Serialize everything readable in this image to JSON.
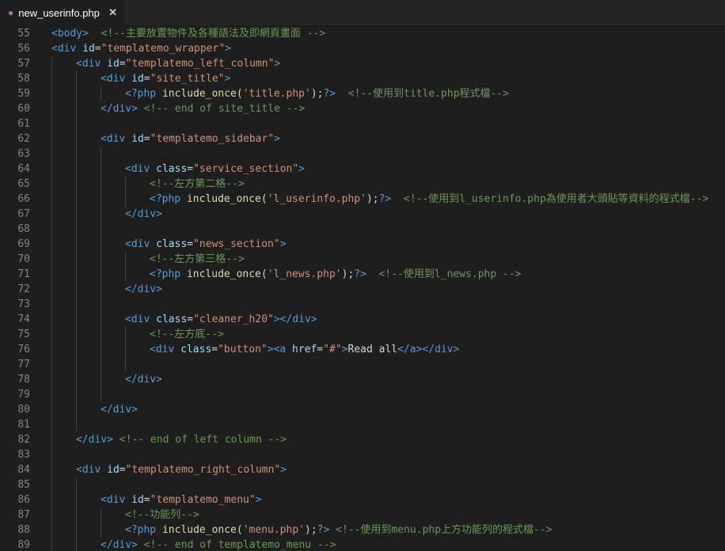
{
  "tab": {
    "filename": "new_userinfo.php",
    "file_icon": "php-elephant-icon",
    "close_glyph": "✕"
  },
  "lines": [
    {
      "n": "55",
      "indent": 0,
      "tokens": [
        [
          "tg",
          "<body>"
        ],
        [
          "tx",
          "  "
        ],
        [
          "cm",
          "<!--主要放置物件及各種語法及即網頁畫面 -->"
        ]
      ]
    },
    {
      "n": "56",
      "indent": 0,
      "tokens": [
        [
          "tg",
          "<div "
        ],
        [
          "at",
          "id"
        ],
        [
          "tx",
          "="
        ],
        [
          "st",
          "\"templatemo_wrapper\""
        ],
        [
          "tg",
          ">"
        ]
      ]
    },
    {
      "n": "57",
      "indent": 1,
      "tokens": [
        [
          "tg",
          "<div "
        ],
        [
          "at",
          "id"
        ],
        [
          "tx",
          "="
        ],
        [
          "st",
          "\"templatemo_left_column\""
        ],
        [
          "tg",
          ">"
        ]
      ]
    },
    {
      "n": "58",
      "indent": 2,
      "tokens": [
        [
          "tg",
          "<div "
        ],
        [
          "at",
          "id"
        ],
        [
          "tx",
          "="
        ],
        [
          "st",
          "\"site_title\""
        ],
        [
          "tg",
          ">"
        ]
      ]
    },
    {
      "n": "59",
      "indent": 3,
      "tokens": [
        [
          "ph",
          "<?php "
        ],
        [
          "fn",
          "include_once"
        ],
        [
          "tx",
          "("
        ],
        [
          "st",
          "'title.php'"
        ],
        [
          "tx",
          ");"
        ],
        [
          "ph",
          "?>"
        ],
        [
          "tx",
          "  "
        ],
        [
          "cm",
          "<!--使用到title.php程式檔-->"
        ]
      ]
    },
    {
      "n": "60",
      "indent": 2,
      "tokens": [
        [
          "tg",
          "</div>"
        ],
        [
          "tx",
          " "
        ],
        [
          "cm",
          "<!-- end of site_title -->"
        ]
      ]
    },
    {
      "n": "61",
      "indent": 0,
      "tokens": []
    },
    {
      "n": "62",
      "indent": 2,
      "tokens": [
        [
          "tg",
          "<div "
        ],
        [
          "at",
          "id"
        ],
        [
          "tx",
          "="
        ],
        [
          "st",
          "\"templatemo_sidebar\""
        ],
        [
          "tg",
          ">"
        ]
      ]
    },
    {
      "n": "63",
      "indent": 0,
      "tokens": []
    },
    {
      "n": "64",
      "indent": 3,
      "tokens": [
        [
          "tg",
          "<div "
        ],
        [
          "at",
          "class"
        ],
        [
          "tx",
          "="
        ],
        [
          "st",
          "\"service_section\""
        ],
        [
          "tg",
          ">"
        ]
      ]
    },
    {
      "n": "65",
      "indent": 4,
      "tokens": [
        [
          "cm",
          "<!--左方第二格-->"
        ]
      ]
    },
    {
      "n": "66",
      "indent": 4,
      "tokens": [
        [
          "ph",
          "<?php "
        ],
        [
          "fn",
          "include_once"
        ],
        [
          "tx",
          "("
        ],
        [
          "st",
          "'l_userinfo.php'"
        ],
        [
          "tx",
          ");"
        ],
        [
          "ph",
          "?>"
        ],
        [
          "tx",
          "  "
        ],
        [
          "cm",
          "<!--使用到l_userinfo.php為使用者大頭貼等資料的程式檔-->"
        ]
      ]
    },
    {
      "n": "67",
      "indent": 3,
      "tokens": [
        [
          "tg",
          "</div>"
        ]
      ]
    },
    {
      "n": "68",
      "indent": 0,
      "tokens": []
    },
    {
      "n": "69",
      "indent": 3,
      "tokens": [
        [
          "tg",
          "<div "
        ],
        [
          "at",
          "class"
        ],
        [
          "tx",
          "="
        ],
        [
          "st",
          "\"news_section\""
        ],
        [
          "tg",
          ">"
        ]
      ]
    },
    {
      "n": "70",
      "indent": 4,
      "tokens": [
        [
          "cm",
          "<!--左方第三格-->"
        ]
      ]
    },
    {
      "n": "71",
      "indent": 4,
      "tokens": [
        [
          "ph",
          "<?php "
        ],
        [
          "fn",
          "include_once"
        ],
        [
          "tx",
          "("
        ],
        [
          "st",
          "'l_news.php'"
        ],
        [
          "tx",
          ");"
        ],
        [
          "ph",
          "?>"
        ],
        [
          "tx",
          "  "
        ],
        [
          "cm",
          "<!--使用到l_news.php -->"
        ]
      ]
    },
    {
      "n": "72",
      "indent": 3,
      "tokens": [
        [
          "tg",
          "</div>"
        ]
      ]
    },
    {
      "n": "73",
      "indent": 0,
      "tokens": []
    },
    {
      "n": "74",
      "indent": 3,
      "tokens": [
        [
          "tg",
          "<div "
        ],
        [
          "at",
          "class"
        ],
        [
          "tx",
          "="
        ],
        [
          "st",
          "\"cleaner_h20\""
        ],
        [
          "tg",
          "></div>"
        ]
      ]
    },
    {
      "n": "75",
      "indent": 4,
      "tokens": [
        [
          "cm",
          "<!--左方底-->"
        ]
      ]
    },
    {
      "n": "76",
      "indent": 4,
      "tokens": [
        [
          "tg",
          "<div "
        ],
        [
          "at",
          "class"
        ],
        [
          "tx",
          "="
        ],
        [
          "st",
          "\"button\""
        ],
        [
          "tg",
          ">"
        ],
        [
          "tg",
          "<a "
        ],
        [
          "at",
          "href"
        ],
        [
          "tx",
          "="
        ],
        [
          "st",
          "\"#\""
        ],
        [
          "tg",
          ">"
        ],
        [
          "tx",
          "Read all"
        ],
        [
          "tg",
          "</a></div>"
        ]
      ]
    },
    {
      "n": "77",
      "indent": 0,
      "tokens": []
    },
    {
      "n": "78",
      "indent": 3,
      "tokens": [
        [
          "tg",
          "</div>"
        ]
      ]
    },
    {
      "n": "79",
      "indent": 0,
      "tokens": []
    },
    {
      "n": "80",
      "indent": 2,
      "tokens": [
        [
          "tg",
          "</div>"
        ]
      ]
    },
    {
      "n": "81",
      "indent": 0,
      "tokens": []
    },
    {
      "n": "82",
      "indent": 1,
      "tokens": [
        [
          "tg",
          "</div>"
        ],
        [
          "tx",
          " "
        ],
        [
          "cm",
          "<!-- end of left column -->"
        ]
      ]
    },
    {
      "n": "83",
      "indent": 0,
      "tokens": []
    },
    {
      "n": "84",
      "indent": 1,
      "tokens": [
        [
          "tg",
          "<div "
        ],
        [
          "at",
          "id"
        ],
        [
          "tx",
          "="
        ],
        [
          "st",
          "\"templatemo_right_column\""
        ],
        [
          "tg",
          ">"
        ]
      ]
    },
    {
      "n": "85",
      "indent": 0,
      "tokens": []
    },
    {
      "n": "86",
      "indent": 2,
      "tokens": [
        [
          "tg",
          "<div "
        ],
        [
          "at",
          "id"
        ],
        [
          "tx",
          "="
        ],
        [
          "st",
          "\"templatemo_menu\""
        ],
        [
          "tg",
          ">"
        ]
      ]
    },
    {
      "n": "87",
      "indent": 3,
      "tokens": [
        [
          "cm",
          "<!--功能列-->"
        ]
      ]
    },
    {
      "n": "88",
      "indent": 3,
      "tokens": [
        [
          "ph",
          "<?php "
        ],
        [
          "fn",
          "include_once"
        ],
        [
          "tx",
          "("
        ],
        [
          "st",
          "'menu.php'"
        ],
        [
          "tx",
          ");"
        ],
        [
          "ph",
          "?>"
        ],
        [
          "tx",
          " "
        ],
        [
          "cm",
          "<!--使用到menu.php上方功能列的程式檔-->"
        ]
      ]
    },
    {
      "n": "89",
      "indent": 2,
      "tokens": [
        [
          "tg",
          "</div>"
        ],
        [
          "tx",
          " "
        ],
        [
          "cm",
          "<!-- end of templatemo_menu -->"
        ]
      ]
    }
  ]
}
